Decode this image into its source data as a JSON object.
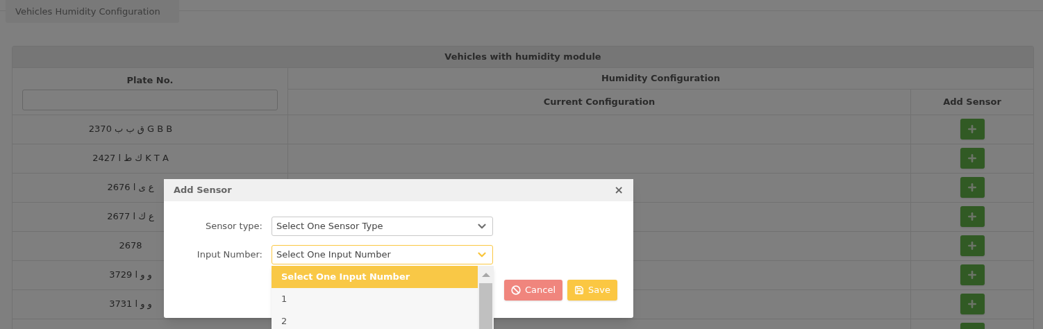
{
  "page_tab": {
    "label": "Vehicles Humidity Configuration"
  },
  "table": {
    "caption": "Vehicles with humidity module",
    "plate_header": "Plate No.",
    "group_header": "Humidity Configuration",
    "config_header": "Current Configuration",
    "add_header": "Add Sensor",
    "rows": [
      {
        "plate": "2370 ق ب ب G B B"
      },
      {
        "plate": "2427 ك ط ا K T A"
      },
      {
        "plate": "2676 ع ى ا"
      },
      {
        "plate": "2677 ع ك ا"
      },
      {
        "plate": "2678"
      },
      {
        "plate": "3729 و و ا"
      },
      {
        "plate": "3731 و و ا"
      },
      {}
    ]
  },
  "dialog": {
    "title": "Add Sensor",
    "close": "×",
    "fields": [
      {
        "label": "Sensor type:",
        "value": "Select One Sensor Type",
        "focused": false
      },
      {
        "label": "Input Number:",
        "value": "Select One Input Number",
        "focused": true,
        "options": [
          {
            "label": "Select One Input Number",
            "selected": true
          },
          {
            "label": "1",
            "selected": false
          },
          {
            "label": "2",
            "selected": false
          }
        ]
      }
    ],
    "buttons": [
      {
        "kind": "cancel",
        "label": "Cancel"
      },
      {
        "kind": "save",
        "label": "Save"
      }
    ]
  }
}
